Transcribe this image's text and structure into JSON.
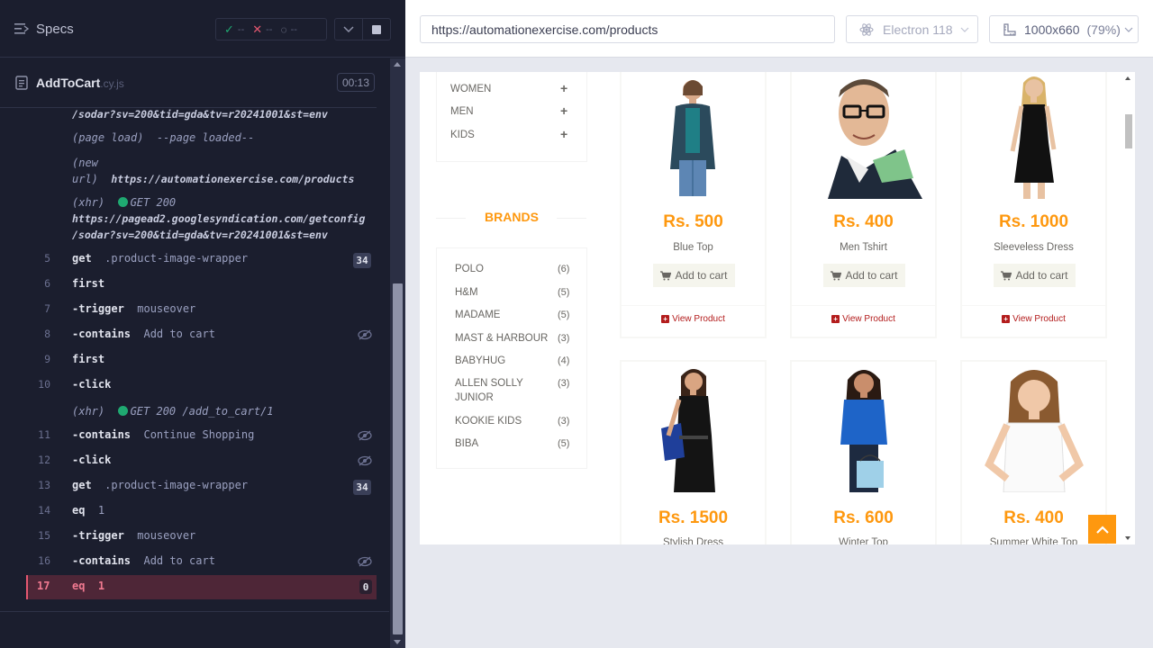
{
  "header": {
    "specs_label": "Specs",
    "stats": {
      "passed": "--",
      "failed": "--",
      "pending": "--"
    }
  },
  "file": {
    "name": "AddToCart",
    "ext": ".cy.js",
    "duration": "00:13"
  },
  "log": {
    "events": {
      "top_fragment": "/sodar?sv=200&tid=gda&tv=r20241001&st=env",
      "page_load_label": "(page load)",
      "page_load_msg": "--page loaded--",
      "new_url_label_1": "(new",
      "new_url_label_2": "url)",
      "new_url_value": "https://automationexercise.com/products",
      "xhr_label": "(xhr)",
      "xhr1_status": "GET 200",
      "xhr1_url_1": "https://pagead2.googlesyndication.com/getconfig",
      "xhr1_url_2": "/sodar?sv=200&tid=gda&tv=r20241001&st=env",
      "xhr2_label": "(xhr)",
      "xhr2_text": "GET 200 /add_to_cart/1"
    },
    "commands": [
      {
        "num": "5",
        "cmd": "get",
        "arg": ".product-image-wrapper",
        "badge": "34"
      },
      {
        "num": "6",
        "cmd": "first",
        "arg": ""
      },
      {
        "num": "7",
        "cmd": "-trigger",
        "arg": "mouseover"
      },
      {
        "num": "8",
        "cmd": "-contains",
        "arg": "Add to cart"
      },
      {
        "num": "9",
        "cmd": "first",
        "arg": ""
      },
      {
        "num": "10",
        "cmd": "-click",
        "arg": ""
      },
      {
        "num": "11",
        "cmd": "-contains",
        "arg": "Continue Shopping"
      },
      {
        "num": "12",
        "cmd": "-click",
        "arg": ""
      },
      {
        "num": "13",
        "cmd": "get",
        "arg": ".product-image-wrapper",
        "badge": "34"
      },
      {
        "num": "14",
        "cmd": "eq",
        "arg": "1"
      },
      {
        "num": "15",
        "cmd": "-trigger",
        "arg": "mouseover"
      },
      {
        "num": "16",
        "cmd": "-contains",
        "arg": "Add to cart"
      },
      {
        "num": "17",
        "cmd": "eq",
        "arg": "1",
        "badge": "0"
      }
    ]
  },
  "browser": {
    "url": "https://automationexercise.com/products",
    "name": "Electron 118",
    "viewport": "1000x660",
    "scale": "(79%)"
  },
  "site": {
    "categories": [
      {
        "label": "WOMEN"
      },
      {
        "label": "MEN"
      },
      {
        "label": "KIDS"
      }
    ],
    "brands_title": "BRANDS",
    "brands": [
      {
        "name": "POLO",
        "count": "(6)"
      },
      {
        "name": "H&M",
        "count": "(5)"
      },
      {
        "name": "MADAME",
        "count": "(5)"
      },
      {
        "name": "MAST & HARBOUR",
        "count": "(3)"
      },
      {
        "name": "BABYHUG",
        "count": "(4)"
      },
      {
        "name": "ALLEN SOLLY JUNIOR",
        "count": "(3)"
      },
      {
        "name": "KOOKIE KIDS",
        "count": "(3)"
      },
      {
        "name": "BIBA",
        "count": "(5)"
      }
    ],
    "add_to_cart": "Add to cart",
    "view_product": "View Product",
    "products": [
      {
        "price": "Rs. 500",
        "name": "Blue Top"
      },
      {
        "price": "Rs. 400",
        "name": "Men Tshirt"
      },
      {
        "price": "Rs. 1000",
        "name": "Sleeveless Dress"
      },
      {
        "price": "Rs. 1500",
        "name": "Stylish Dress"
      },
      {
        "price": "Rs. 600",
        "name": "Winter Top"
      },
      {
        "price": "Rs. 400",
        "name": "Summer White Top"
      }
    ]
  },
  "colors": {
    "accent": "#fe980f",
    "pass": "#1fa971",
    "fail": "#e45770",
    "panel_bg": "#1b1e2e"
  }
}
